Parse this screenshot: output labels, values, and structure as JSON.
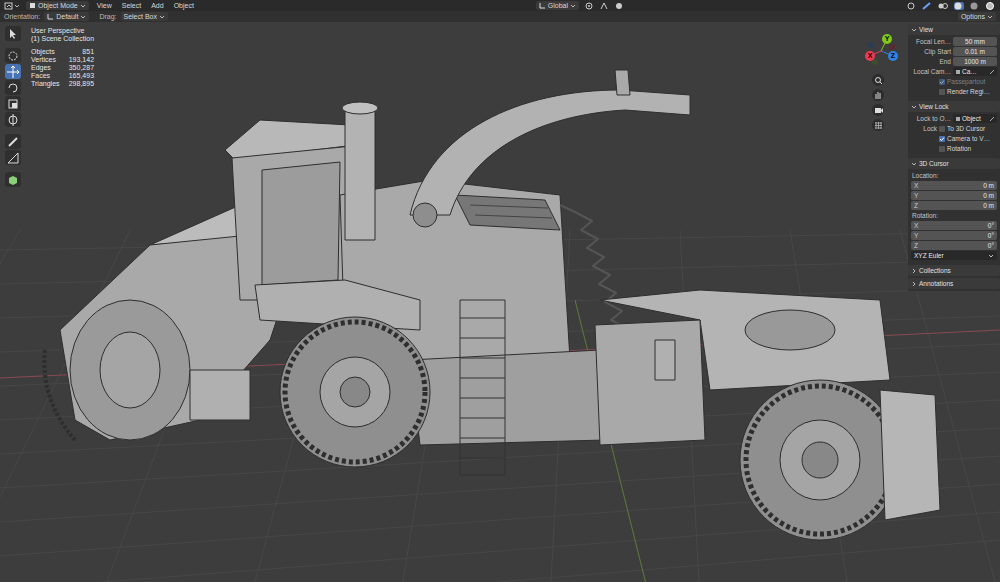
{
  "header": {
    "mode": "Object Mode",
    "menus": [
      "View",
      "Select",
      "Add",
      "Object"
    ],
    "transform_orientation": "Global"
  },
  "tool_settings": {
    "orientation_label": "Orientation:",
    "orientation": "Default",
    "drag_label": "Drag:",
    "drag": "Select Box",
    "options": "Options"
  },
  "tools": [
    {
      "selected": false
    },
    {
      "selected": false
    },
    {
      "selected": true
    },
    {
      "selected": false
    },
    {
      "selected": false
    },
    {
      "selected": false
    },
    {
      "selected": false
    },
    {
      "selected": false
    },
    {
      "selected": false
    }
  ],
  "overlay": {
    "view_name": "User Perspective",
    "collection": "(1) Scene Collection",
    "stats": [
      {
        "label": "Objects",
        "value": "851"
      },
      {
        "label": "Vertices",
        "value": "193,142"
      },
      {
        "label": "Edges",
        "value": "350,287"
      },
      {
        "label": "Faces",
        "value": "165,493"
      },
      {
        "label": "Triangles",
        "value": "298,895"
      }
    ]
  },
  "gizmo": {
    "axes": [
      {
        "label": "X",
        "color": "#f03a55"
      },
      {
        "label": "Y",
        "color": "#7fc81a"
      },
      {
        "label": "Z",
        "color": "#2f84e3"
      }
    ]
  },
  "sidebar": {
    "sections": [
      {
        "title": "View",
        "expanded": true,
        "rows": [
          {
            "kind": "field",
            "label": "Focal Len…",
            "value": "50 mm"
          },
          {
            "kind": "field",
            "label": "Clip Start",
            "value": "0.01 m"
          },
          {
            "kind": "field",
            "label": "End",
            "value": "1000 m"
          },
          {
            "kind": "picker",
            "label": "Local Cam…",
            "value": "Ca…"
          },
          {
            "kind": "checkbox",
            "caption": "",
            "label": "Passepartout",
            "checked": true,
            "disabled": true
          },
          {
            "kind": "checkbox",
            "caption": "",
            "label": "Render Regi…",
            "checked": false,
            "disabled": false
          }
        ]
      },
      {
        "title": "View Lock",
        "expanded": true,
        "rows": [
          {
            "kind": "picker",
            "label": "Lock to O…",
            "value": "Object"
          },
          {
            "kind": "checkbox",
            "caption": "Lock",
            "label": "To 3D Cursor",
            "checked": false,
            "disabled": false
          },
          {
            "kind": "checkbox",
            "caption": "",
            "label": "Camera to V…",
            "checked": true,
            "disabled": false
          },
          {
            "kind": "checkbox",
            "caption": "",
            "label": "Rotation",
            "checked": false,
            "disabled": false
          }
        ]
      },
      {
        "title": "3D Cursor",
        "expanded": true,
        "rows": [
          {
            "kind": "heading",
            "label": "Location:"
          },
          {
            "kind": "vector",
            "label": "X",
            "value": "0 m"
          },
          {
            "kind": "vector",
            "label": "Y",
            "value": "0 m"
          },
          {
            "kind": "vector",
            "label": "Z",
            "value": "0 m"
          },
          {
            "kind": "heading",
            "label": "Rotation:"
          },
          {
            "kind": "vector",
            "label": "X",
            "value": "0°"
          },
          {
            "kind": "vector",
            "label": "Y",
            "value": "0°"
          },
          {
            "kind": "vector",
            "label": "Z",
            "value": "0°"
          },
          {
            "kind": "dropdown",
            "value": "XYZ Euler"
          }
        ]
      },
      {
        "title": "Collections",
        "expanded": false,
        "rows": []
      },
      {
        "title": "Annotations",
        "expanded": false,
        "rows": []
      }
    ]
  }
}
